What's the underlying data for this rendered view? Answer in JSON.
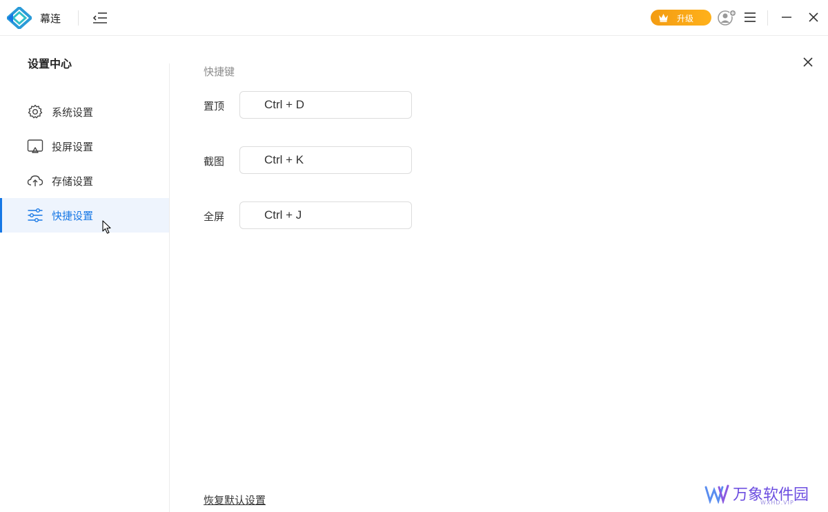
{
  "titlebar": {
    "app_name": "幕连",
    "upgrade_label": "升级",
    "colors": {
      "accent": "#1677e5",
      "upgrade": "#f5a623"
    }
  },
  "sidebar": {
    "title": "设置中心",
    "items": [
      {
        "label": "系统设置",
        "icon": "gear-icon"
      },
      {
        "label": "投屏设置",
        "icon": "screencast-icon"
      },
      {
        "label": "存储设置",
        "icon": "cloud-icon"
      },
      {
        "label": "快捷设置",
        "icon": "sliders-icon",
        "active": true
      }
    ]
  },
  "main": {
    "section_title": "快捷键",
    "shortcuts": [
      {
        "label": "置顶",
        "value": "Ctrl + D"
      },
      {
        "label": "截图",
        "value": "Ctrl + K"
      },
      {
        "label": "全屏",
        "value": "Ctrl + J"
      }
    ],
    "reset_label": "恢复默认设置"
  },
  "watermark": {
    "text": "万象软件园",
    "sub": "WXHD.VIP"
  }
}
